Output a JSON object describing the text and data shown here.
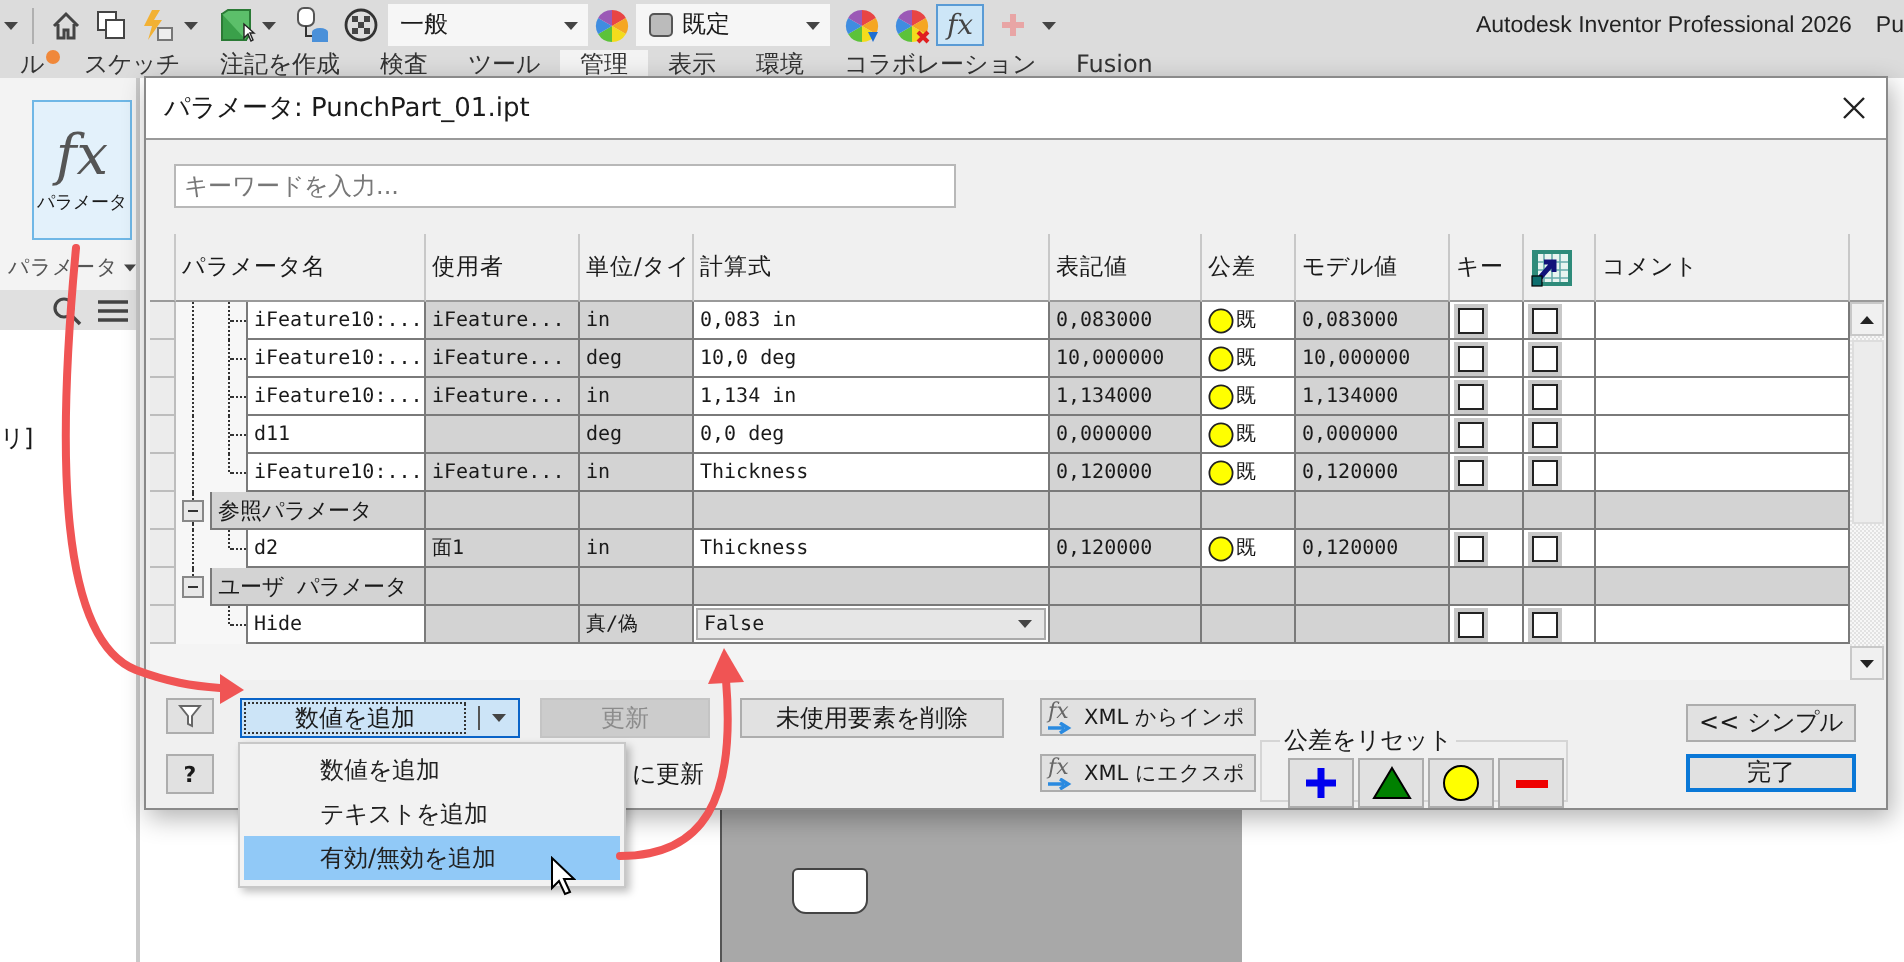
{
  "toolbar": {
    "style_select": {
      "value": "一般"
    },
    "appearance_select": {
      "value": "既定"
    },
    "fx_toggle": {
      "label": "fx",
      "on": true
    }
  },
  "app_title": {
    "product": "Autodesk Inventor Professional 2026",
    "document": "Pu"
  },
  "ribbon_tabs": [
    {
      "label": "ル",
      "selected": false,
      "alert": true
    },
    {
      "label": "スケッチ",
      "selected": false,
      "alert": false
    },
    {
      "label": "注記を作成",
      "selected": false,
      "alert": false
    },
    {
      "label": "検査",
      "selected": false,
      "alert": false
    },
    {
      "label": "ツール",
      "selected": false,
      "alert": false
    },
    {
      "label": "管理",
      "selected": true,
      "alert": false
    },
    {
      "label": "表示",
      "selected": false,
      "alert": false
    },
    {
      "label": "環境",
      "selected": false,
      "alert": false
    },
    {
      "label": "コラボレーション",
      "selected": false,
      "alert": false
    },
    {
      "label": "Fusion",
      "selected": false,
      "alert": false
    }
  ],
  "ribbon_panel": {
    "button": {
      "icon": "fx",
      "label": "パラメータ",
      "selected": true
    },
    "panel_label": "パラメータ"
  },
  "browser": {
    "text": "リ]"
  },
  "dialog": {
    "title": "パラメータ: PunchPart_01.ipt",
    "search": {
      "placeholder": "キーワードを入力..."
    },
    "table": {
      "columns": [
        {
          "kind": "text",
          "label": "パラメータ名"
        },
        {
          "kind": "text",
          "label": "使用者"
        },
        {
          "kind": "text",
          "label": "単位/タイ"
        },
        {
          "kind": "text",
          "label": "計算式"
        },
        {
          "kind": "text",
          "label": "表記値"
        },
        {
          "kind": "text",
          "label": "公差"
        },
        {
          "kind": "text",
          "label": "モデル値"
        },
        {
          "kind": "text",
          "label": "キー"
        },
        {
          "kind": "icon"
        },
        {
          "kind": "text",
          "label": "コメント"
        }
      ],
      "continued_rows": [
        {
          "kind": "numeric",
          "name": "iFeature10:...",
          "used_by": "iFeature...",
          "unit": "in",
          "equation": "0,083 in",
          "nominal": "0,083000",
          "tolerance": "既",
          "model_value": "0,083000",
          "key": false,
          "export": false
        },
        {
          "kind": "numeric",
          "name": "iFeature10:...",
          "used_by": "iFeature...",
          "unit": "deg",
          "equation": "10,0 deg",
          "nominal": "10,000000",
          "tolerance": "既",
          "model_value": "10,000000",
          "key": false,
          "export": false
        },
        {
          "kind": "numeric",
          "name": "iFeature10:...",
          "used_by": "iFeature...",
          "unit": "in",
          "equation": "1,134 in",
          "nominal": "1,134000",
          "tolerance": "既",
          "model_value": "1,134000",
          "key": false,
          "export": false
        },
        {
          "kind": "numeric",
          "name": "d11",
          "unit": "deg",
          "equation": "0,0 deg",
          "nominal": "0,000000",
          "tolerance": "既",
          "model_value": "0,000000",
          "key": false,
          "export": false
        },
        {
          "kind": "numeric",
          "name": "iFeature10:...",
          "used_by": "iFeature...",
          "unit": "in",
          "equation": "Thickness",
          "nominal": "0,120000",
          "tolerance": "既",
          "model_value": "0,120000",
          "key": false,
          "export": false
        }
      ],
      "groups": [
        {
          "label": "参照パラメータ",
          "expanded": true,
          "children": [
            {
              "kind": "numeric",
              "name": "d2",
              "used_by": "面1",
              "unit": "in",
              "equation": "Thickness",
              "nominal": "0,120000",
              "tolerance": "既",
              "model_value": "0,120000",
              "key": false,
              "export": false
            }
          ]
        },
        {
          "label": "ユーザ パラメータ",
          "expanded": true,
          "children": [
            {
              "kind": "boolean",
              "name": "Hide",
              "unit": "真/偽",
              "equation": "False",
              "key": false,
              "export": false
            }
          ]
        }
      ]
    },
    "bottom": {
      "add_button": {
        "label": "数値を追加"
      },
      "update_button": {
        "label": "更新",
        "disabled": true
      },
      "purge_button": {
        "label": "未使用要素を削除"
      },
      "import_button": {
        "icon_text": "fx",
        "label": "XML からインポ"
      },
      "export_button": {
        "icon_text": "fx",
        "label": "XML にエクスポ"
      },
      "help_button": {
        "label": "?"
      },
      "immediate_update": {
        "label": "に更新"
      },
      "tolerance_reset": {
        "legend": "公差をリセット"
      },
      "simple_button": {
        "label": "<< シンプル"
      },
      "done_button": {
        "label": "完了",
        "default": true
      }
    }
  },
  "add_menu": {
    "items": [
      {
        "label": "数値を追加",
        "selected": false
      },
      {
        "label": "テキストを追加",
        "selected": false
      },
      {
        "label": "有効/無効を追加",
        "selected": true
      }
    ]
  }
}
